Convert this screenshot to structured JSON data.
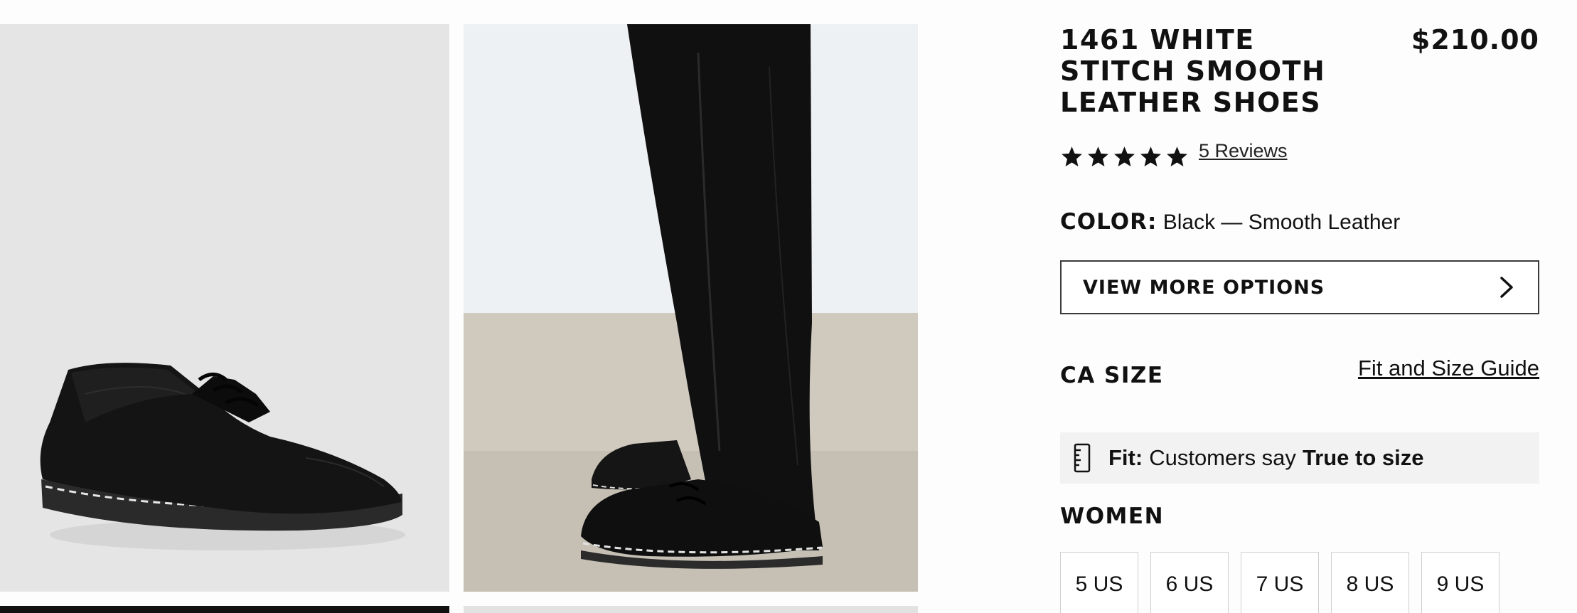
{
  "product": {
    "title": "1461 WHITE STITCH SMOOTH LEATHER SHOES",
    "price": "$210.00",
    "rating": {
      "value": 5,
      "max": 5,
      "reviews_link": "5 Reviews"
    },
    "color": {
      "label": "COLOR:",
      "value": "Black — Smooth Leather"
    },
    "more_options_label": "VIEW MORE OPTIONS",
    "size_section": {
      "heading": "CA SIZE",
      "guide_link": "Fit and Size Guide",
      "fit": {
        "label": "Fit:",
        "text": "Customers say",
        "value": "True to size"
      },
      "group_heading": "WOMEN",
      "sizes": [
        "5 US",
        "6 US",
        "7 US",
        "8 US",
        "9 US"
      ]
    }
  },
  "icons": {
    "star": "star-icon",
    "chevron": "chevron-right-icon",
    "fit": "ruler-icon"
  },
  "colors": {
    "text": "#111111",
    "button_border": "#3a3a3a",
    "fit_bg": "#f2f2f2",
    "size_border": "#cfcfcf"
  }
}
